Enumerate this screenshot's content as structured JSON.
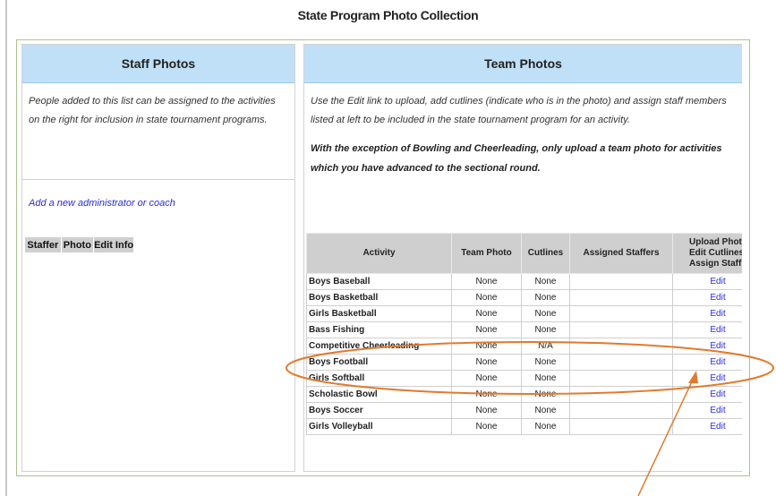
{
  "page": {
    "title": "State Program Photo Collection"
  },
  "staff_panel": {
    "header": "Staff Photos",
    "description": "People added to this list can be assigned to the activities on the right for inclusion in state tournament programs.",
    "add_link": "Add a new administrator or coach",
    "columns": [
      "Staffer",
      "Photo",
      "Edit Info"
    ]
  },
  "team_panel": {
    "header": "Team Photos",
    "description": "Use the Edit link to upload, add cutlines (indicate who is in the photo) and assign staff members listed at left to be included in the state tournament program for an activity.",
    "notice_line1": "With the exception of Bowling and Cheerleading, only upload a team photo for activities",
    "notice_line2": "which you have advanced to the sectional round.",
    "columns": {
      "activity": "Activity",
      "team_photo": "Team Photo",
      "cutlines": "Cutlines",
      "assigned_staffers": "Assigned Staffers",
      "upload_1": "Upload Photo",
      "upload_2": "Edit Cutlines",
      "upload_3": "Assign Staff"
    },
    "rows": [
      {
        "activity": "Boys Baseball",
        "team_photo": "None",
        "cutlines": "None",
        "staffers": "",
        "action": "Edit"
      },
      {
        "activity": "Boys Basketball",
        "team_photo": "None",
        "cutlines": "None",
        "staffers": "",
        "action": "Edit"
      },
      {
        "activity": "Girls Basketball",
        "team_photo": "None",
        "cutlines": "None",
        "staffers": "",
        "action": "Edit"
      },
      {
        "activity": "Bass Fishing",
        "team_photo": "None",
        "cutlines": "None",
        "staffers": "",
        "action": "Edit"
      },
      {
        "activity": "Competitive Cheerleading",
        "team_photo": "None",
        "cutlines": "N/A",
        "staffers": "",
        "action": "Edit"
      },
      {
        "activity": "Boys Football",
        "team_photo": "None",
        "cutlines": "None",
        "staffers": "",
        "action": "Edit"
      },
      {
        "activity": "Girls Softball",
        "team_photo": "None",
        "cutlines": "None",
        "staffers": "",
        "action": "Edit"
      },
      {
        "activity": "Scholastic Bowl",
        "team_photo": "None",
        "cutlines": "None",
        "staffers": "",
        "action": "Edit"
      },
      {
        "activity": "Boys Soccer",
        "team_photo": "None",
        "cutlines": "None",
        "staffers": "",
        "action": "Edit"
      },
      {
        "activity": "Girls Volleyball",
        "team_photo": "None",
        "cutlines": "None",
        "staffers": "",
        "action": "Edit"
      }
    ]
  },
  "annotation": {
    "color": "#e27a2c"
  }
}
